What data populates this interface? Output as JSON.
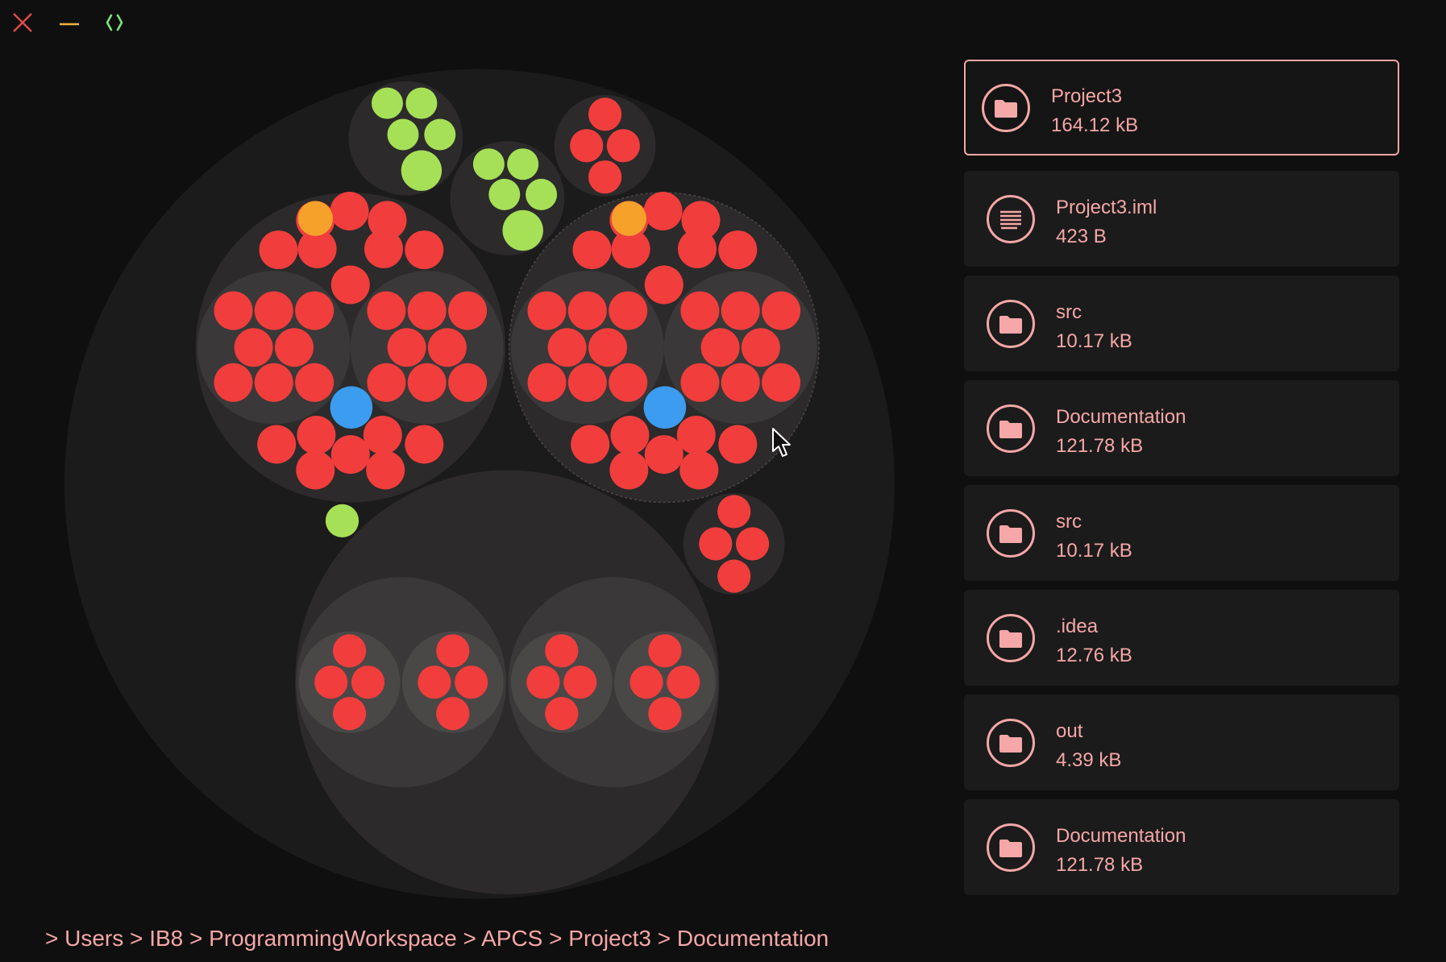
{
  "window": {
    "close_icon": "close-x-icon",
    "minimize_icon": "minimize-dash-icon",
    "code_icon": "code-brackets-icon",
    "colors": {
      "close": "#e14b4b",
      "minimize": "#f3b23b",
      "code": "#7fe27f"
    }
  },
  "visualization": {
    "colors": {
      "file_default": "#f23d3d",
      "file_green": "#a6e057",
      "file_orange": "#f5a12a",
      "file_blue": "#3b9cf0",
      "dir_level_1": "#1c1b1b",
      "dir_level_2": "#2c2a2a",
      "dir_level_3": "#3a3838",
      "dir_level_4": "#4a4747"
    }
  },
  "panel": {
    "items": [
      {
        "name": "Project3",
        "size": "164.12 kB",
        "icon": "folder-icon",
        "selected": true
      },
      {
        "name": "Project3.iml",
        "size": "423 B",
        "icon": "file-text-icon",
        "selected": false
      },
      {
        "name": "src",
        "size": "10.17 kB",
        "icon": "folder-icon",
        "selected": false
      },
      {
        "name": "Documentation",
        "size": "121.78 kB",
        "icon": "folder-icon",
        "selected": false
      },
      {
        "name": "src",
        "size": "10.17 kB",
        "icon": "folder-icon",
        "selected": false
      },
      {
        "name": ".idea",
        "size": "12.76 kB",
        "icon": "folder-icon",
        "selected": false
      },
      {
        "name": "out",
        "size": "4.39 kB",
        "icon": "folder-icon",
        "selected": false
      },
      {
        "name": "Documentation",
        "size": "121.78 kB",
        "icon": "folder-icon",
        "selected": false
      }
    ],
    "accent": "#f6a7a7"
  },
  "breadcrumb": {
    "parts": [
      "Users",
      "IB8",
      "ProgrammingWorkspace",
      "APCS",
      "Project3",
      "Documentation"
    ],
    "separator": ">"
  }
}
